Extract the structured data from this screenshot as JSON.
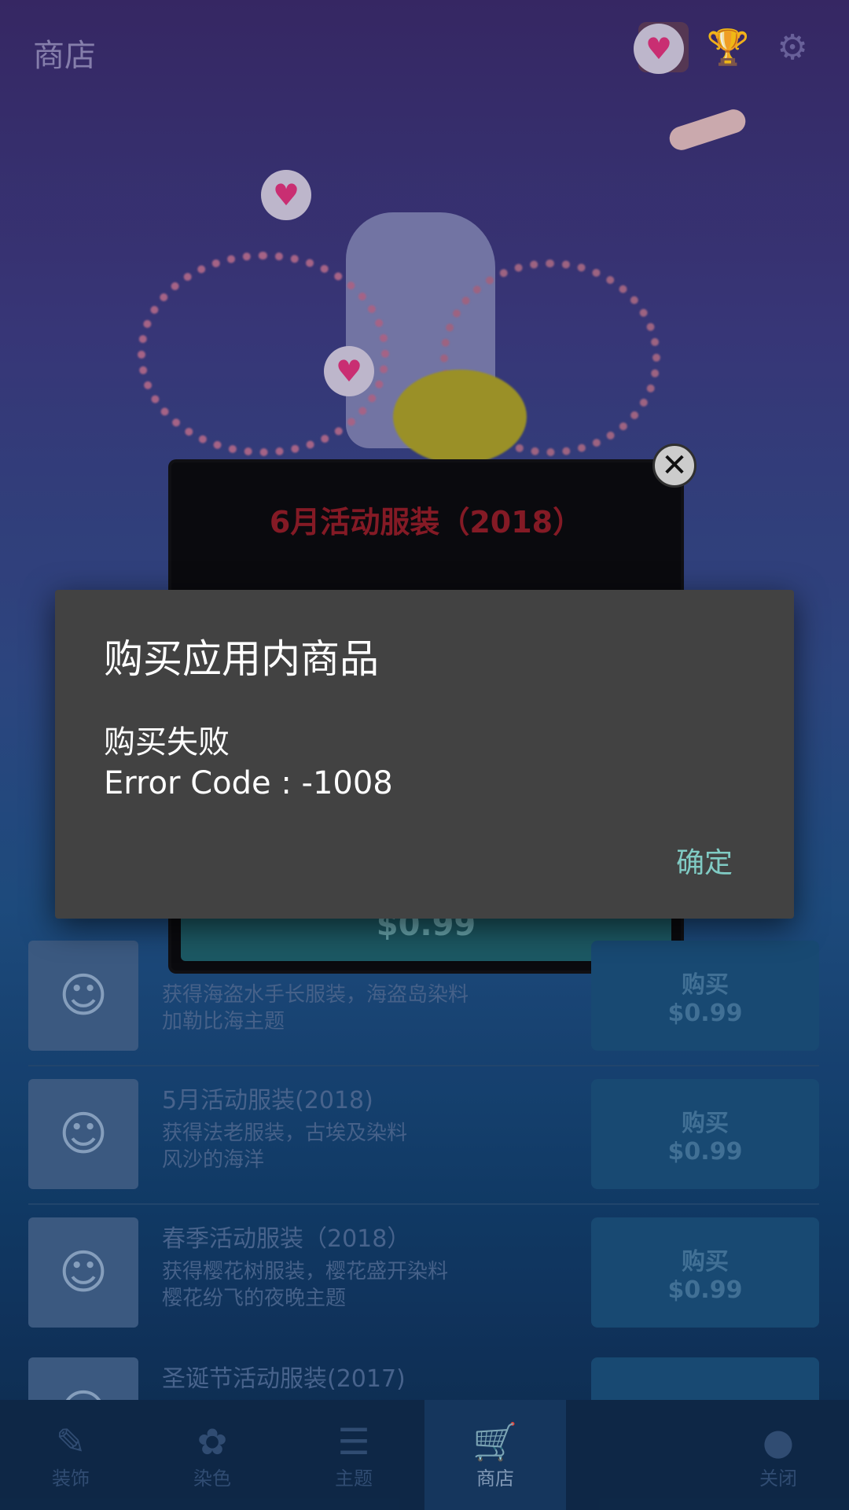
{
  "header": {
    "title": "商店"
  },
  "scene": {
    "heart": "♥"
  },
  "shop_modal": {
    "title": "6月活动服装（2018）",
    "price": "$0.99",
    "close": "✕"
  },
  "shop_list": [
    {
      "title": "",
      "desc": "获得海盗水手长服装，海盗岛染料\n加勒比海主题",
      "buy": "购买",
      "price": "$0.99"
    },
    {
      "title": "5月活动服装(2018)",
      "desc": "获得法老服装，古埃及染料\n风沙的海洋",
      "buy": "购买",
      "price": "$0.99"
    },
    {
      "title": "春季活动服装（2018）",
      "desc": "获得樱花树服装，樱花盛开染料\n樱花纷飞的夜晚主题",
      "buy": "购买",
      "price": "$0.99"
    },
    {
      "title": "圣诞节活动服装(2017)",
      "desc": "",
      "buy": "",
      "price": ""
    }
  ],
  "bottom_nav": [
    {
      "label": "装饰",
      "icon": "✎"
    },
    {
      "label": "染色",
      "icon": "✿"
    },
    {
      "label": "主题",
      "icon": "☰"
    },
    {
      "label": "商店",
      "icon": "🛒"
    },
    {
      "label": "",
      "icon": ""
    },
    {
      "label": "关闭",
      "icon": "●"
    }
  ],
  "dialog": {
    "title": "购买应用内商品",
    "message_line1": "购买失败",
    "message_line2": "Error Code : -1008",
    "ok": "确定"
  },
  "colors": {
    "dialog_bg": "#424242",
    "accent": "#80cbc4"
  }
}
